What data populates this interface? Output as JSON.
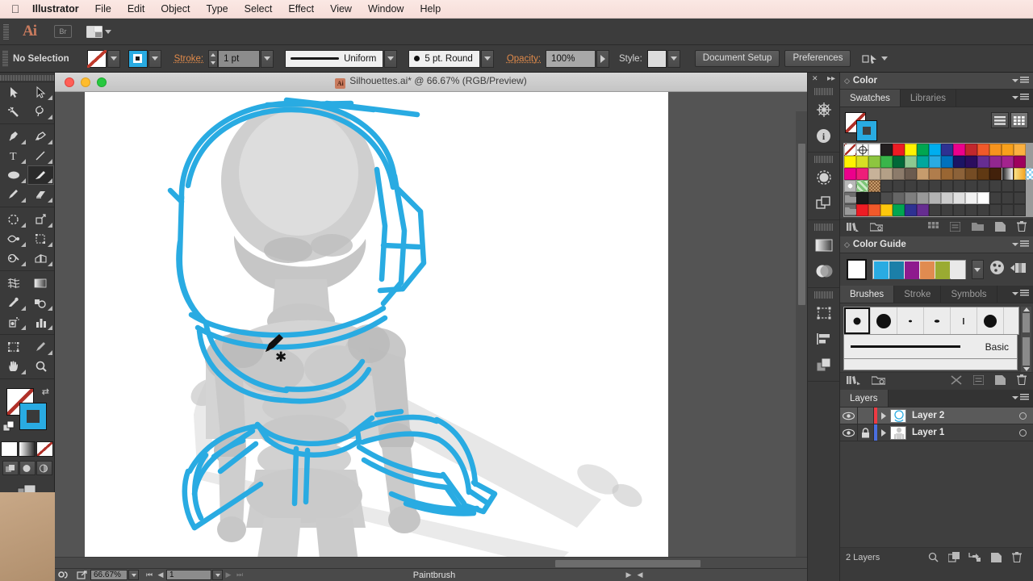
{
  "menubar": {
    "apple_icon": "apple-logo",
    "items": [
      {
        "label": "Illustrator",
        "bold": true
      },
      {
        "label": "File"
      },
      {
        "label": "Edit"
      },
      {
        "label": "Object"
      },
      {
        "label": "Type"
      },
      {
        "label": "Select"
      },
      {
        "label": "Effect"
      },
      {
        "label": "View"
      },
      {
        "label": "Window"
      },
      {
        "label": "Help"
      }
    ]
  },
  "appbar": {
    "logo": "Ai",
    "bridge_label": "Br",
    "arrange_icon": "arrange-documents-icon"
  },
  "control_bar": {
    "selection_status": "No Selection",
    "fill_swatch": "none",
    "stroke_swatch_color": "#29abe2",
    "stroke_label": "Stroke:",
    "stroke_weight": "1 pt",
    "profile_label": "Uniform",
    "brush_label": "5 pt. Round",
    "opacity_label": "Opacity:",
    "opacity_value": "100%",
    "style_label": "Style:",
    "document_setup_label": "Document Setup",
    "preferences_label": "Preferences"
  },
  "toolbar": {
    "active_tool": "paintbrush-tool",
    "tools": [
      [
        "selection-tool",
        "direct-selection-tool"
      ],
      [
        "magic-wand-tool",
        "lasso-tool"
      ],
      [
        "pen-tool",
        "curvature-tool"
      ],
      [
        "type-tool",
        "line-segment-tool"
      ],
      [
        "ellipse-tool",
        "paintbrush-tool"
      ],
      [
        "pencil-tool",
        "eraser-tool"
      ],
      [
        "rotate-tool",
        "scale-tool"
      ],
      [
        "width-tool",
        "free-transform-tool"
      ],
      [
        "shape-builder-tool",
        "perspective-grid-tool"
      ],
      [
        "mesh-tool",
        "gradient-tool"
      ],
      [
        "eyedropper-tool",
        "blend-tool"
      ],
      [
        "symbol-sprayer-tool",
        "column-graph-tool"
      ],
      [
        "artboard-tool",
        "slice-tool"
      ],
      [
        "hand-tool",
        "zoom-tool"
      ]
    ],
    "fill_color": "none",
    "stroke_color": "#29abe2"
  },
  "document": {
    "title": "Silhouettes.ai* @ 66.67% (RGB/Preview)",
    "file_name": "Silhouettes.ai*",
    "zoom": "66.67%",
    "color_mode": "RGB/Preview",
    "window_controls": [
      "close-button",
      "minimize-button",
      "zoom-button"
    ]
  },
  "artwork": {
    "sketch_stroke_color": "#29abe2",
    "reference_fill_color": "#c9c9c9",
    "cursor": "paintbrush-cursor"
  },
  "icon_dock": {
    "icons": [
      "collapse-panels-icon",
      "expand-panels-icon",
      "adobe-stock-icon",
      "document-info-icon",
      "transparency-icon",
      "pathfinder-icon",
      "gradient-icon",
      "transparency-panel-icon",
      "transform-icon",
      "align-icon",
      "appearance-icon"
    ]
  },
  "panels": {
    "color": {
      "title": "Color"
    },
    "swatches": {
      "tabs": [
        {
          "label": "Swatches",
          "active": true
        },
        {
          "label": "Libraries",
          "active": false
        }
      ],
      "fill_swatch": "none",
      "stroke_swatch_color": "#29abe2",
      "view_list_icon": "list-view-icon",
      "view_grid_icon": "grid-view-icon",
      "rows": [
        [
          "#ffffff",
          "#808080",
          "#ffffff",
          "#231f20",
          "#ed1c24",
          "#fff200",
          "#00a651",
          "#00aeef",
          "#2e3192",
          "#ec008c",
          "#c1272d",
          "#f1592a",
          "#f7941e",
          "#f9a01b",
          "#fbb040"
        ],
        [
          "#fff200",
          "#d7df23",
          "#8dc63f",
          "#39b54a",
          "#006838",
          "#8dc891",
          "#00a79d",
          "#29abe2",
          "#0071bc",
          "#1b1464",
          "#2b0d5e",
          "#662d91",
          "#92278f",
          "#a3238e",
          "#9e005d"
        ],
        [
          "#ec008c",
          "#ed1e79",
          "#c7b299",
          "#b4a087",
          "#8c7b6b",
          "#6b5b4f",
          "#c69c6d",
          "#b07d4c",
          "#996633",
          "#8c6239",
          "#754c24",
          "#603913",
          "#42210b",
          "#e8e8e8",
          "#f7c844"
        ],
        [
          "#f2f2f2",
          "#7fba6e",
          "#b08c6b",
          "#3f3f3f",
          "#3f3f3f",
          "#3f3f3f",
          "#3f3f3f",
          "#3f3f3f",
          "#3f3f3f",
          "#3f3f3f",
          "#3f3f3f",
          "#3f3f3f",
          "#3f3f3f",
          "#3f3f3f",
          "#3f3f3f"
        ],
        [
          "#6e6e6e",
          "#1a1a1a",
          "#333333",
          "#4d4d4d",
          "#666666",
          "#7f7f7f",
          "#999999",
          "#b3b3b3",
          "#cccccc",
          "#e0e0e0",
          "#f2f2f2",
          "#ffffff",
          "#3f3f3f",
          "#3f3f3f",
          "#3f3f3f"
        ],
        [
          "#6e6e6e",
          "#ed1c24",
          "#f1592a",
          "#fdc70c",
          "#00a651",
          "#2e3192",
          "#662d91",
          "#3f3f3f",
          "#3f3f3f",
          "#3f3f3f",
          "#3f3f3f",
          "#3f3f3f",
          "#3f3f3f",
          "#3f3f3f",
          "#3f3f3f"
        ]
      ],
      "footer_icons": [
        "swatch-libraries-icon",
        "show-libraries-icon",
        "color-group-icon",
        "show-swatch-kinds-icon",
        "swatch-options-icon",
        "new-color-group-icon",
        "new-swatch-icon",
        "delete-swatch-icon"
      ]
    },
    "color_guide": {
      "title": "Color Guide",
      "base_color": "#ffffff",
      "harmony_colors": [
        "#29abe2",
        "#1b7fa8",
        "#8e1a8e",
        "#e08b50",
        "#9aab32",
        "#e9e9e9"
      ],
      "edit_colors_icon": "edit-colors-icon",
      "limit_colors_icon": "limit-colors-icon"
    },
    "brushes": {
      "tabs": [
        {
          "label": "Brushes",
          "active": true
        },
        {
          "label": "Stroke",
          "active": false
        },
        {
          "label": "Symbols",
          "active": false
        }
      ],
      "cells": [
        {
          "name": "5-pt-round-brush",
          "size": 9,
          "selected": true
        },
        {
          "name": "large-round-brush",
          "size": 18,
          "selected": false
        },
        {
          "name": "fine-point-brush",
          "size": 4,
          "selected": false
        },
        {
          "name": "small-oval-brush",
          "size": 6,
          "selected": false
        },
        {
          "name": "thin-line-brush",
          "size": 2,
          "selected": false
        },
        {
          "name": "round-brush",
          "size": 16,
          "selected": false
        }
      ],
      "basic_label": "Basic",
      "footer_icons": [
        "brush-libraries-icon",
        "libraries-panel-icon",
        "remove-brush-stroke-icon",
        "brush-options-icon",
        "new-brush-icon",
        "delete-brush-icon"
      ]
    },
    "layers": {
      "title": "Layers",
      "rows": [
        {
          "name": "Layer 2",
          "color": "#ee3a43",
          "visible": true,
          "locked": false,
          "selected": true,
          "thumbnail": "sketch-thumbnail"
        },
        {
          "name": "Layer 1",
          "color": "#4a6ee0",
          "visible": true,
          "locked": true,
          "selected": false,
          "thumbnail": "reference-thumbnail"
        }
      ],
      "count_label": "2 Layers",
      "footer_icons": [
        "locate-object-icon",
        "make-clipping-mask-icon",
        "create-sublayer-icon",
        "create-new-layer-icon",
        "delete-layer-icon"
      ]
    }
  },
  "status_bar": {
    "zoom_value": "66.67%",
    "page_value": "1",
    "tool_name": "Paintbrush",
    "icons": [
      "preferences-icon",
      "share-icon",
      "first-page-icon",
      "prev-page-icon",
      "next-page-icon",
      "last-page-icon",
      "status-menu-icon",
      "scroll-left-icon"
    ]
  }
}
